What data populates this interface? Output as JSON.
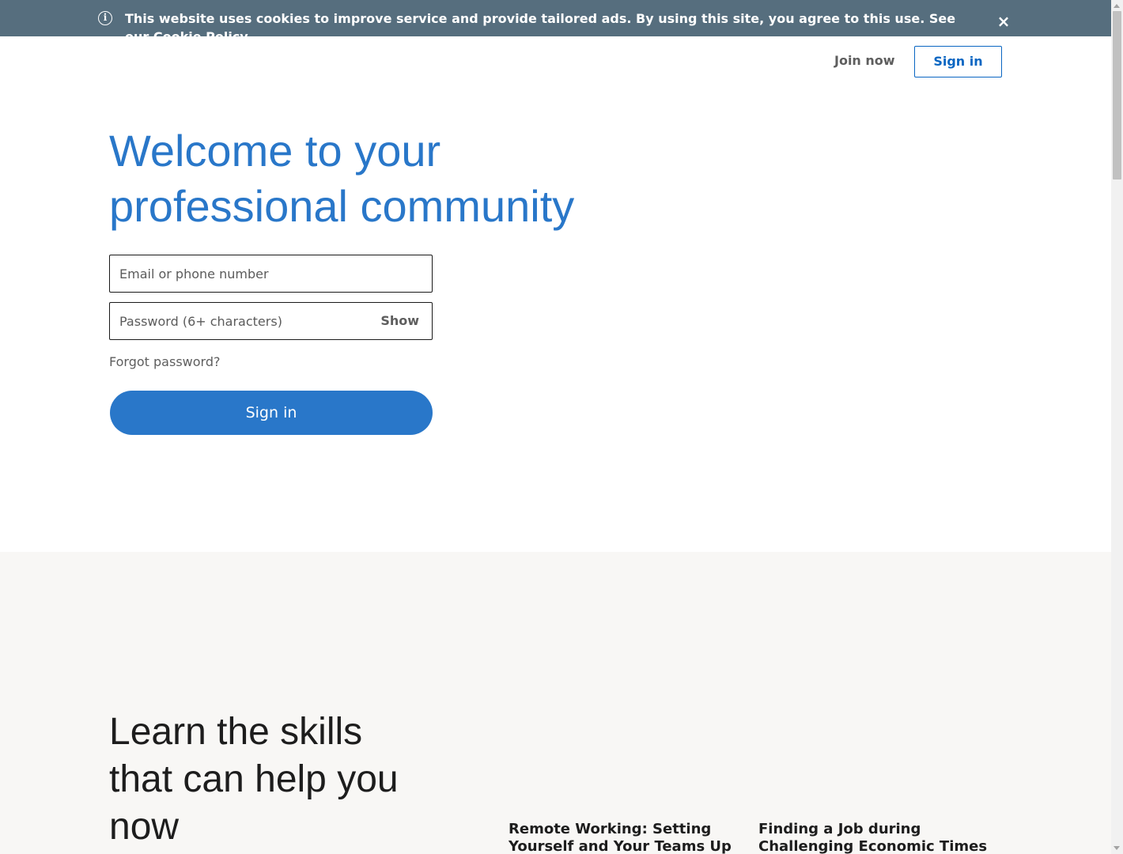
{
  "cookie_banner": {
    "text": "This website uses cookies to improve service and provide tailored ads. By using this site, you agree to this use. See our ",
    "link": "Cookie Policy",
    "close_label": "×",
    "info_icon": "i"
  },
  "header": {
    "join_now": "Join now",
    "sign_in": "Sign in"
  },
  "hero": {
    "title": "Welcome to your professional community",
    "email_placeholder": "Email or phone number",
    "password_placeholder": "Password (6+ characters)",
    "show_label": "Show",
    "forgot_password": "Forgot password?",
    "sign_in_button": "Sign in"
  },
  "skills": {
    "title": "Learn the skills that can help you now",
    "courses": [
      "Remote Working: Setting Yourself and Your Teams Up for Success",
      "Finding a Job during Challenging Economic Times"
    ]
  },
  "icons": {
    "info": "info-icon",
    "close": "close-icon"
  }
}
